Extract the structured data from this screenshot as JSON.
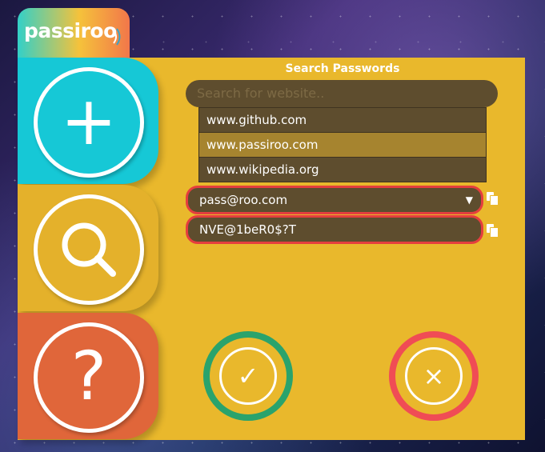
{
  "app": {
    "logo_text": "passiroo"
  },
  "sidebar": {
    "add_glyph": "+",
    "search_icon": "magnifier-icon",
    "help_glyph": "?"
  },
  "main": {
    "title": "Search Passwords",
    "search_placeholder": "Search for website..",
    "dropdown_items": [
      {
        "label": "www.github.com",
        "active": false
      },
      {
        "label": "www.passiroo.com",
        "active": true
      },
      {
        "label": "www.wikipedia.org",
        "active": false
      }
    ],
    "email_value": "pass@roo.com",
    "password_value": "NVE@1beR0$?T"
  },
  "actions": {
    "confirm_glyph": "✓",
    "cancel_glyph": "×"
  },
  "colors": {
    "panel": "#e9b82c",
    "add": "#16c8d6",
    "search": "#e4b12b",
    "help": "#e0663a",
    "confirm": "#2aa36c",
    "cancel": "#f04c55",
    "field_border": "#e53e3e",
    "field_bg": "#5e4d2e"
  }
}
